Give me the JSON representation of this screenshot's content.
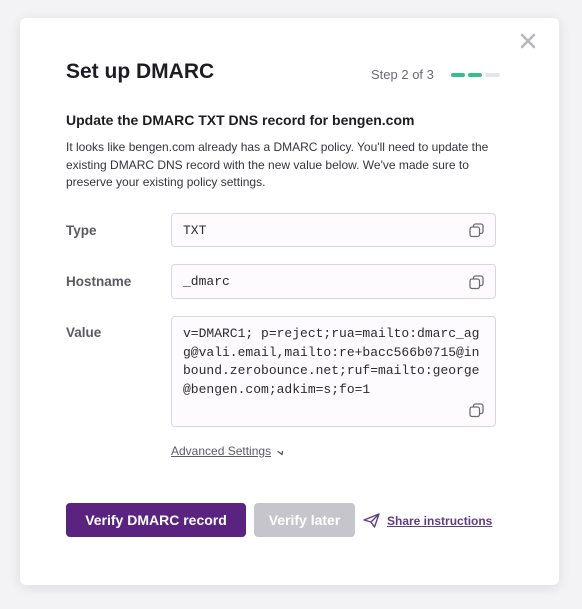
{
  "modal": {
    "title": "Set up DMARC",
    "step_text": "Step 2 of 3",
    "steps_total": 3,
    "steps_completed": 2,
    "subtitle": "Update the DMARC TXT DNS record for bengen.com",
    "description": "It looks like bengen.com already has a DMARC policy. You'll need to update the existing DMARC DNS record with the new value below. We've made sure to preserve your existing policy settings.",
    "fields": {
      "type": {
        "label": "Type",
        "value": "TXT"
      },
      "hostname": {
        "label": "Hostname",
        "value": "_dmarc"
      },
      "value": {
        "label": "Value",
        "value": "v=DMARC1; p=reject;rua=mailto:dmarc_agg@vali.email,mailto:re+bacc566b0715@inbound.zerobounce.net;ruf=mailto:george@bengen.com;adkim=s;fo=1"
      }
    },
    "advanced_settings_label": "Advanced Settings",
    "primary_button": "Verify DMARC record",
    "secondary_button": "Verify later",
    "share_link": "Share instructions"
  },
  "icons": {
    "close": "close-icon",
    "copy": "copy-icon",
    "chevron": "chevron-down-icon",
    "share": "paper-plane-icon"
  },
  "colors": {
    "primary": "#5b2380",
    "progress_done": "#35c08a",
    "progress_todo": "#e6e6ea",
    "disabled_button": "#c6c5cb",
    "link": "#5d3f86"
  }
}
